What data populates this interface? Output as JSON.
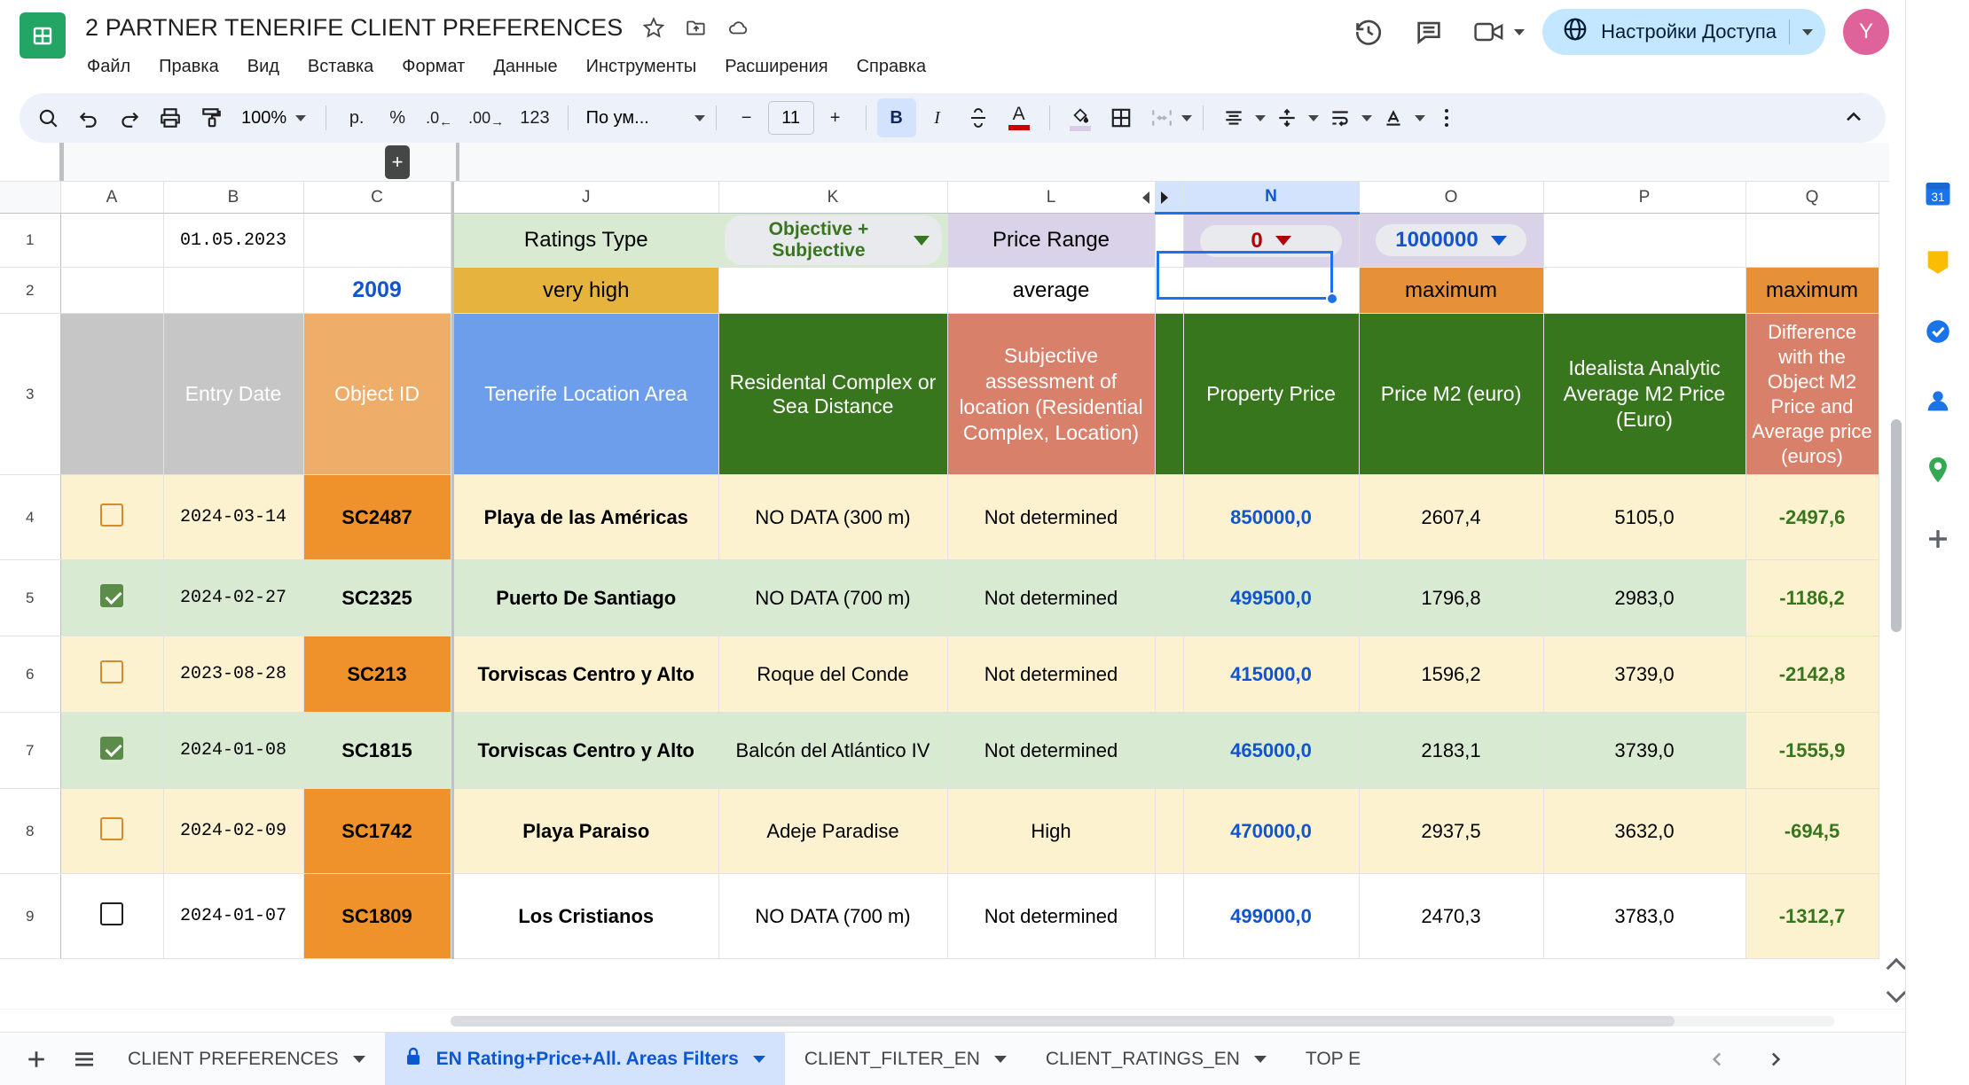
{
  "app": {
    "logo_icon": "sheets-logo-icon",
    "doc_title": "2 PARTNER TENERIFE CLIENT PREFERENCES",
    "title_icons": [
      "star-icon",
      "move-to-folder-icon",
      "cloud-saved-icon"
    ],
    "menu": [
      "Файл",
      "Правка",
      "Вид",
      "Вставка",
      "Формат",
      "Данные",
      "Инструменты",
      "Расширения",
      "Справка"
    ],
    "right_icons": [
      "history-icon",
      "comment-icon",
      "meet-camera-icon",
      "meet-chevron-icon"
    ],
    "share_label": "Настройки Доступа",
    "share_icon": "globe-icon",
    "share_caret_icon": "chevron-down-icon",
    "avatar_initial": "Y",
    "accent_blue": "#1a73e8",
    "brand_green": "#23A566"
  },
  "toolbar": {
    "icons": [
      "search-icon",
      "undo-icon",
      "redo-icon",
      "print-icon",
      "paint-format-icon"
    ],
    "zoom_value": "100%",
    "currency_label": "р.",
    "percent_label": "%",
    "decimal_dec_label": ".0",
    "decimal_inc_label": ".00",
    "more_formats_label": "123",
    "font_name": "По ум...",
    "font_size": "11",
    "minus_label": "−",
    "plus_label": "+",
    "bold_label": "B",
    "italic_label": "I",
    "strikethrough_icon": "strikethrough-icon",
    "text_color_label": "A",
    "fill_color_icon": "fill-color-icon",
    "borders_icon": "borders-icon",
    "merge_icon": "merge-cells-icon",
    "halign_icon": "horizontal-align-icon",
    "valign_icon": "vertical-align-icon",
    "wrap_icon": "text-wrap-icon",
    "rotate_icon": "text-rotation-icon",
    "more_icon": "more-options-icon",
    "collapse_icon": "collapse-toolbar-icon"
  },
  "grid": {
    "column_letters": [
      "A",
      "B",
      "C",
      "J",
      "K",
      "L",
      "N",
      "O",
      "P",
      "Q"
    ],
    "row_numbers": [
      "1",
      "2",
      "3",
      "4",
      "5",
      "6",
      "7",
      "8",
      "9"
    ],
    "add_column_button": "+",
    "collapse_left_icon": "collapse-left-icon",
    "expand_right_icon": "expand-right-icon",
    "row1": {
      "b": "01.05.2023",
      "j": "Ratings Type",
      "k": "Objective + Subjective",
      "l": "Price Range",
      "n": "0",
      "o": "1000000"
    },
    "row2": {
      "c": "2009",
      "j": "very high",
      "l": "average",
      "o": "maximum",
      "q": "maximum"
    },
    "headers": {
      "b": "Entry Date",
      "c": "Object ID",
      "j": "Tenerife Location Area",
      "k": "Residental Complex or Sea Distance",
      "l": "Subjective assessment of location (Residential Complex, Location)",
      "n": "Property Price",
      "o": "Price  M2  (euro)",
      "p": "Idealista Analytic Average M2 Price (Euro)",
      "q": "Difference with the Object M2 Price and Average price (euros)"
    },
    "rows": [
      {
        "num": "4",
        "checked": false,
        "cbstyle": "orange",
        "date": "2024-03-14",
        "id": "SC2487",
        "area": "Playa de las Américas",
        "complex": "NO DATA (300 m)",
        "subj": "Not determined",
        "price": "850000,0",
        "m2": "2607,4",
        "avg": "5105,0",
        "diff": "-2497,6",
        "band": "cream",
        "idband": "orange-strong"
      },
      {
        "num": "5",
        "checked": true,
        "cbstyle": "green",
        "date": "2024-02-27",
        "id": "SC2325",
        "area": "Puerto De Santiago",
        "complex": "NO DATA (700 m)",
        "subj": "Not determined",
        "price": "499500,0",
        "m2": "1796,8",
        "avg": "2983,0",
        "diff": "-1186,2",
        "band": "green",
        "idband": "green"
      },
      {
        "num": "6",
        "checked": false,
        "cbstyle": "orange",
        "date": "2023-08-28",
        "id": "SC213",
        "area": "Torviscas Centro y Alto",
        "complex": "Roque del Conde",
        "subj": "Not determined",
        "price": "415000,0",
        "m2": "1596,2",
        "avg": "3739,0",
        "diff": "-2142,8",
        "band": "cream",
        "idband": "orange-strong"
      },
      {
        "num": "7",
        "checked": true,
        "cbstyle": "green",
        "date": "2024-01-08",
        "id": "SC1815",
        "area": "Torviscas Centro y Alto",
        "complex": "Balcón del Atlántico IV",
        "subj": "Not determined",
        "price": "465000,0",
        "m2": "2183,1",
        "avg": "3739,0",
        "diff": "-1555,9",
        "band": "green",
        "idband": "green"
      },
      {
        "num": "8",
        "checked": false,
        "cbstyle": "orange",
        "date": "2024-02-09",
        "id": "SC1742",
        "area": "Playa Paraiso",
        "complex": "Adeje Paradise",
        "subj": "High",
        "price": "470000,0",
        "m2": "2937,5",
        "avg": "3632,0",
        "diff": "-694,5",
        "band": "cream",
        "idband": "orange-strong"
      },
      {
        "num": "9",
        "checked": false,
        "cbstyle": "plain",
        "date": "2024-01-07",
        "id": "SC1809",
        "area": "Los Cristianos",
        "complex": "NO DATA (700 m)",
        "subj": "Not determined",
        "price": "499000,0",
        "m2": "2470,3",
        "avg": "3783,0",
        "diff": "-1312,7",
        "band": "white",
        "idband": "orange-strong"
      }
    ]
  },
  "tabs": {
    "add_sheet_icon": "add-sheet-icon",
    "all_sheets_icon": "all-sheets-icon",
    "items": [
      {
        "label": "CLIENT PREFERENCES",
        "active": false,
        "locked": false
      },
      {
        "label": "EN Rating+Price+All. Areas Filters",
        "active": true,
        "locked": true
      },
      {
        "label": "CLIENT_FILTER_EN",
        "active": false,
        "locked": false
      },
      {
        "label": "CLIENT_RATINGS_EN",
        "active": false,
        "locked": false
      },
      {
        "label": "TOP E",
        "active": false,
        "locked": false
      }
    ],
    "prev_icon": "tab-prev-icon",
    "next_icon": "tab-next-icon",
    "lock_icon": "lock-icon"
  },
  "sidepanel": {
    "items": [
      "calendar-icon",
      "keep-icon",
      "tasks-icon",
      "contacts-icon",
      "maps-icon",
      "add-apps-icon"
    ]
  }
}
